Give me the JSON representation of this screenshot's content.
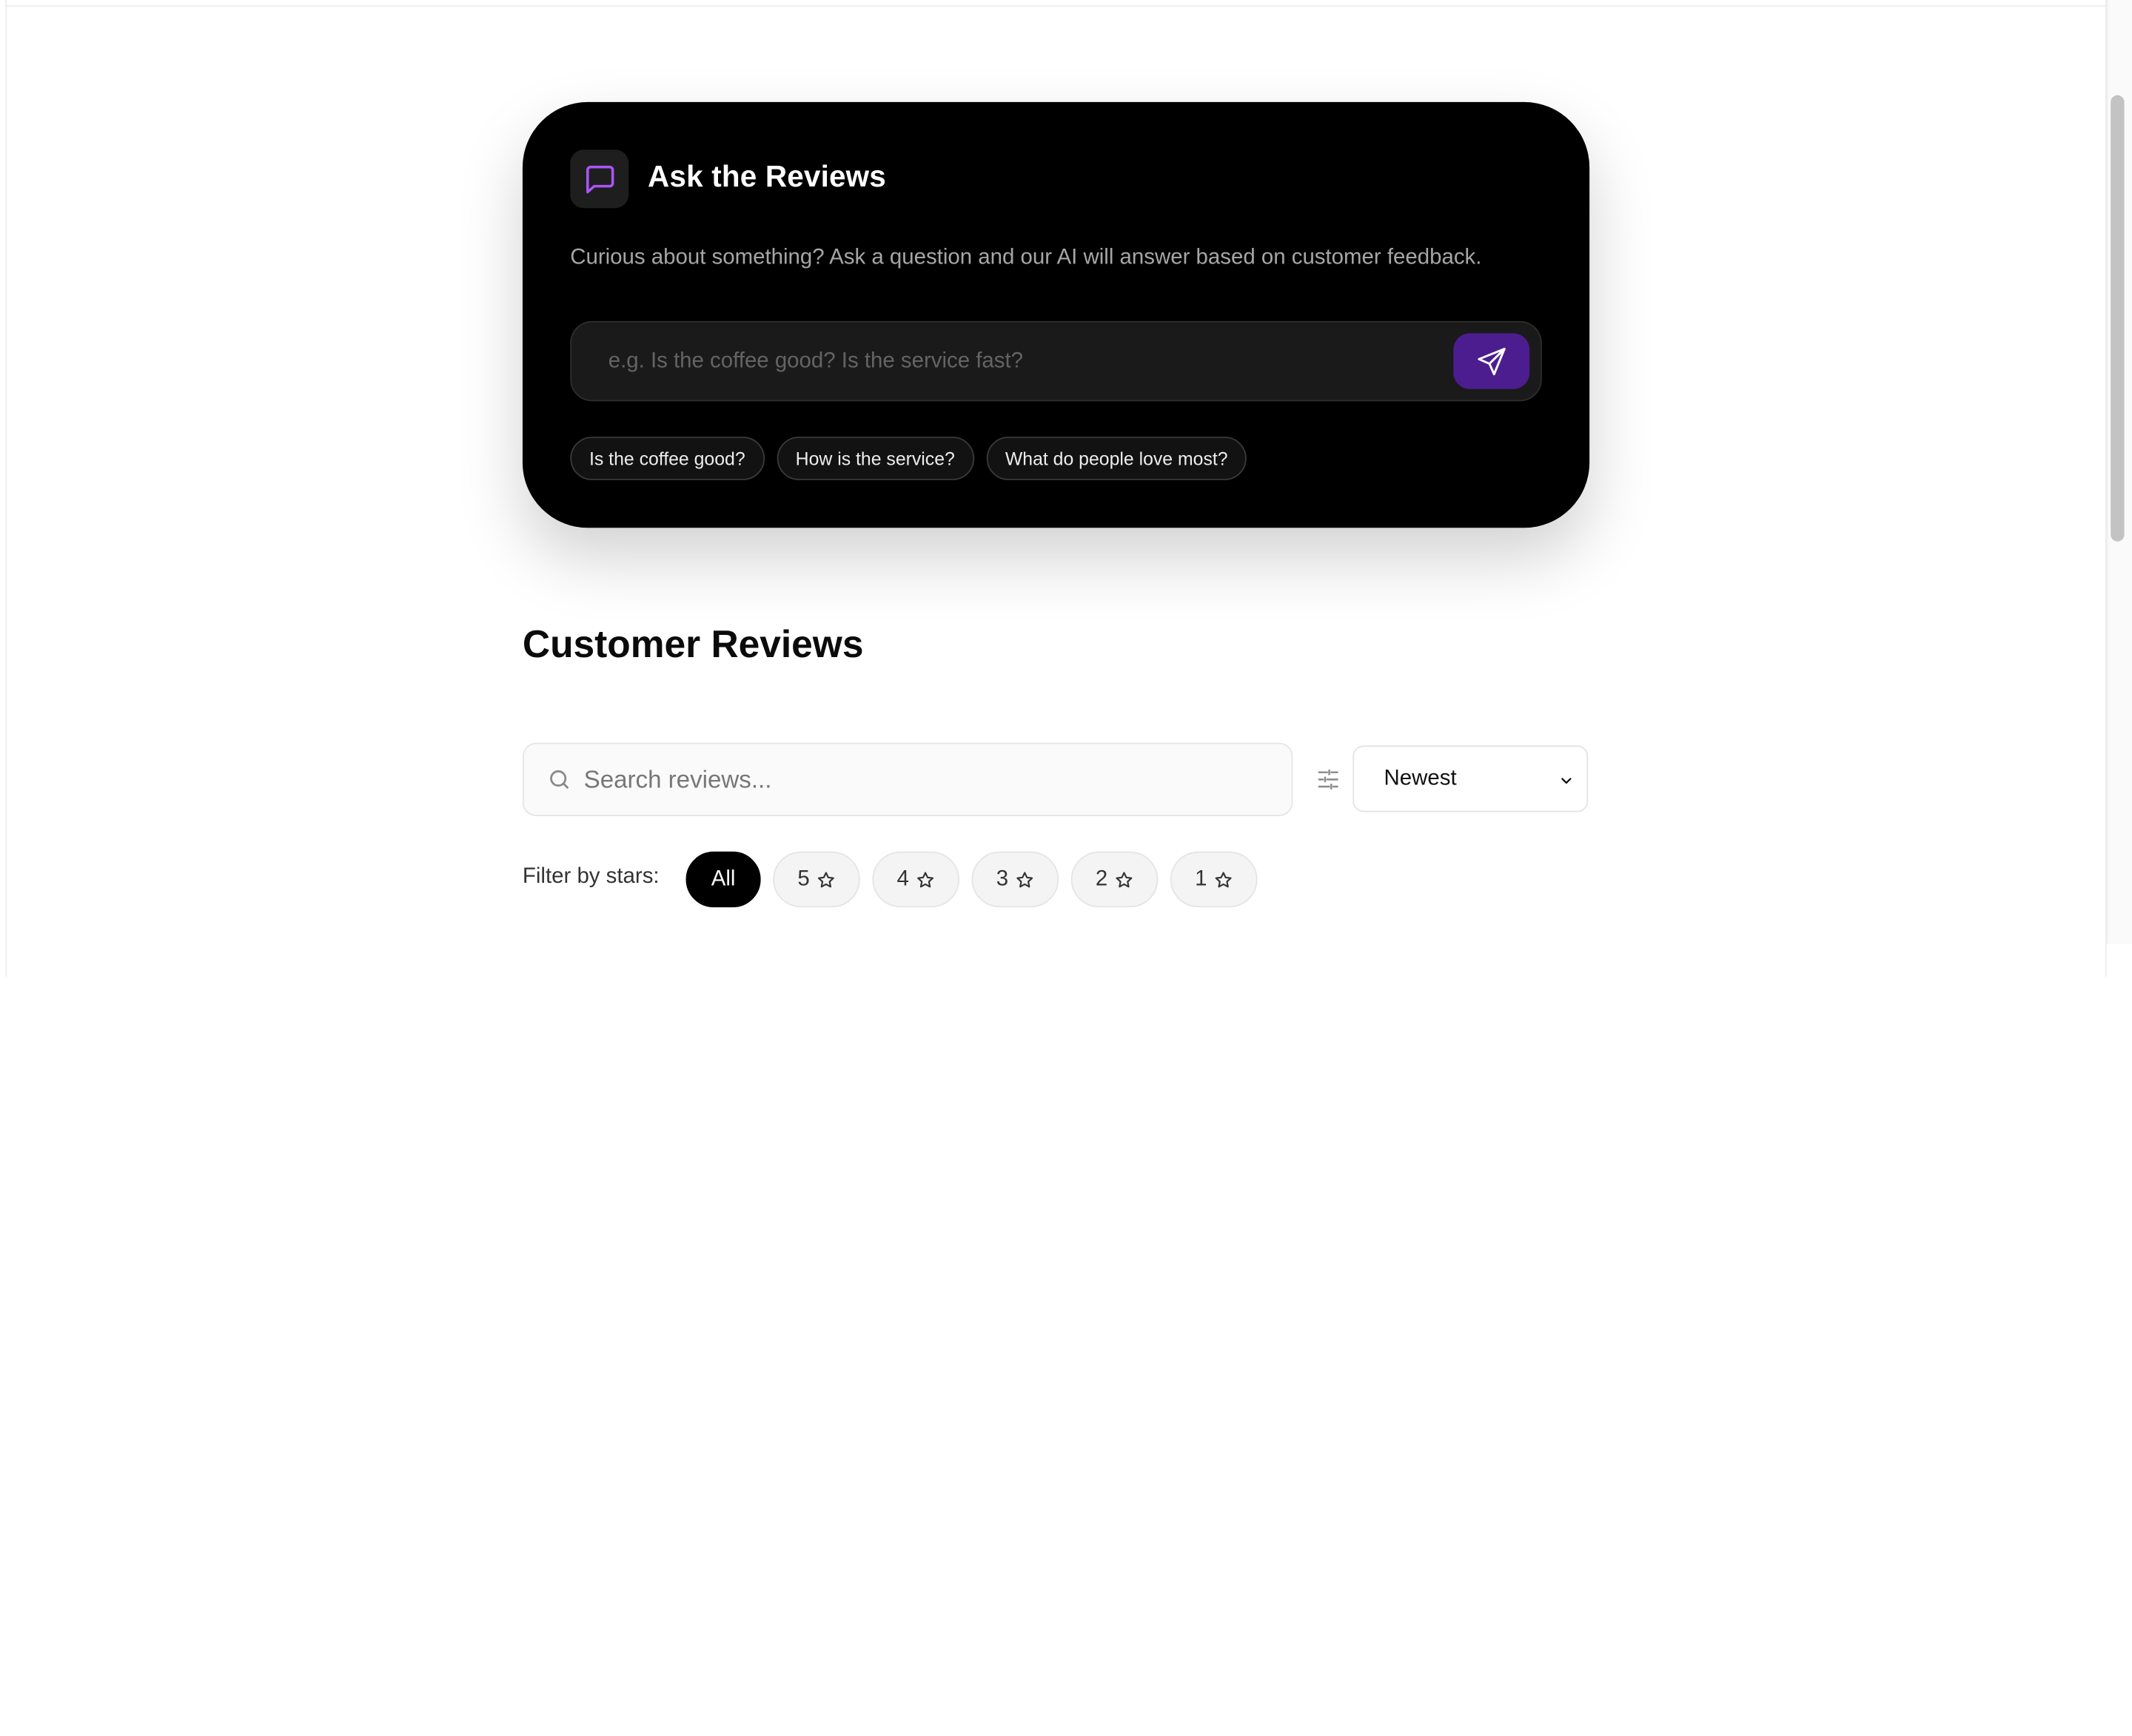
{
  "ask": {
    "title": "Ask the Reviews",
    "description": "Curious about something? Ask a question and our AI will answer based on customer feedback.",
    "input_placeholder": "e.g. Is the coffee good? Is the service fast?",
    "send_icon": "send-icon",
    "chips": [
      {
        "label": "Is the coffee good?"
      },
      {
        "label": "How is the service?"
      },
      {
        "label": "What do people love most?"
      }
    ],
    "accent_color": "#a855f7",
    "send_button_color": "#4c1d8f"
  },
  "reviews": {
    "title": "Customer Reviews",
    "search_placeholder": "Search reviews...",
    "sort_selected": "Newest",
    "filter_label": "Filter by stars:",
    "star_filters": [
      {
        "label": "All",
        "active": true
      },
      {
        "label": "5",
        "active": false
      },
      {
        "label": "4",
        "active": false
      },
      {
        "label": "3",
        "active": false
      },
      {
        "label": "2",
        "active": false
      },
      {
        "label": "1",
        "active": false
      }
    ]
  }
}
